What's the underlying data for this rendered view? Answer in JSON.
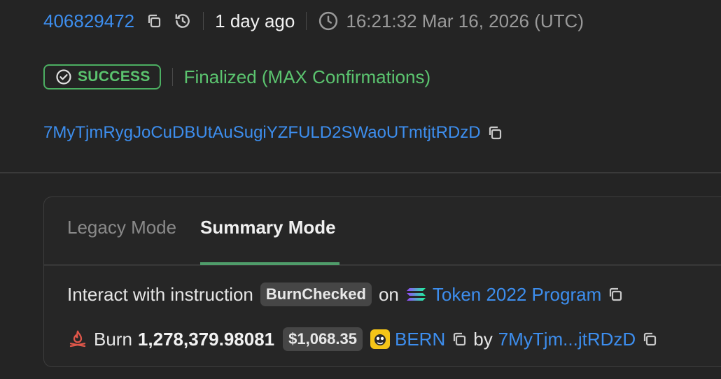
{
  "header": {
    "slot": "406829472",
    "age": "1 day ago",
    "timestamp": "16:21:32 Mar 16, 2026 (UTC)"
  },
  "status": {
    "badge": "SUCCESS",
    "confirmation": "Finalized (MAX Confirmations)"
  },
  "signer": "7MyTjmRygJoCuDBUtAuSugiYZFULD2SWaoUTmtjtRDzD",
  "tabs": {
    "legacy": "Legacy Mode",
    "summary": "Summary Mode"
  },
  "summary": {
    "interact_prefix": "Interact with instruction",
    "instruction": "BurnChecked",
    "on_word": "on",
    "program": "Token 2022 Program",
    "action": "Burn",
    "amount": "1,278,379.98081",
    "usd_value": "$1,068.35",
    "token": "BERN",
    "by_word": "by",
    "account_short": "7MyTjm...jtRDzD"
  },
  "colors": {
    "link": "#3d8eee",
    "success": "#5bc46f",
    "background": "#242424",
    "tab_active_underline": "#4f9c6a"
  },
  "icons": [
    "copy-icon",
    "history-icon",
    "clock-icon",
    "check-circle-icon",
    "solana-icon",
    "fire-icon",
    "bern-token-icon"
  ]
}
